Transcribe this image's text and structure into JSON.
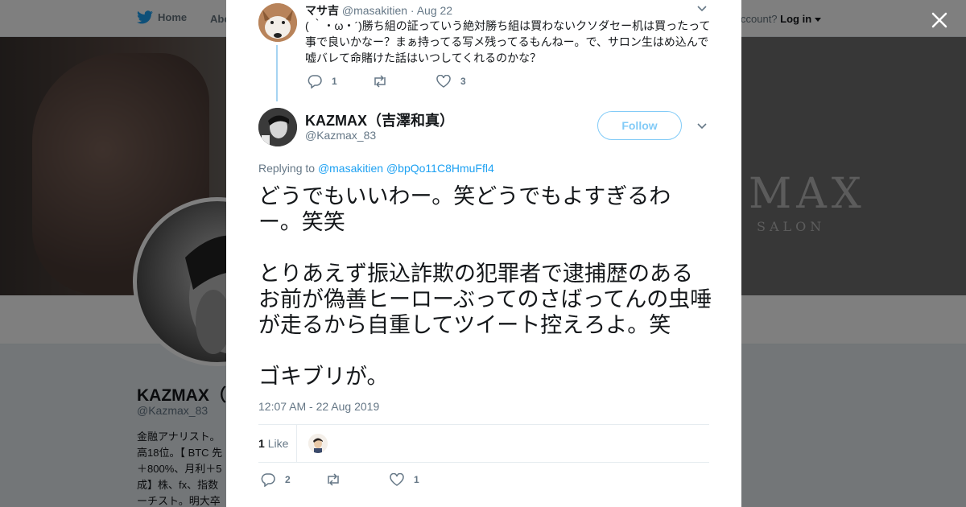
{
  "nav": {
    "home_label": "Home",
    "about_label": "Abo",
    "account_prompt": "ccount?",
    "login_label": "Log in"
  },
  "cover": {
    "logo_text": "MAX",
    "logo_sub": "SALON"
  },
  "profile": {
    "name": "KAZMAX（",
    "handle": "@Kazmax_83",
    "bio": "金融アナリスト。\n高18位。【 BTC 先\n＋800%、月利＋5\n成】株、fx、指数\nーチスト。明大卒"
  },
  "reply_tweet": {
    "name": "マサ吉",
    "handle": "@masakitien",
    "date": "Aug 22",
    "text": "( ｀・ω・´)勝ち組の証っていう絶対勝ち組は買わないクソダセー机は買ったって事で良いかなー？まぁ持ってる写メ残ってるもんねー。で、サロン生はめ込んで嘘バレて命賭けた話はいつしてくれるのかな？",
    "replies": "1",
    "retweets": "",
    "likes": "3"
  },
  "main_tweet": {
    "name": "KAZMAX（吉澤和真）",
    "handle": "@Kazmax_83",
    "follow_label": "Follow",
    "replying_to_label": "Replying to",
    "replying_to_1": "@masakitien",
    "replying_to_2": "@bpQo11C8HmuFfl4",
    "text_line1": "どうでもいいわー。笑どうでもよすぎるわー。笑笑",
    "text_line2": "とりあえず振込詐欺の犯罪者で逮捕歴のあるお前が偽善ヒーローぶってのさばってんの虫唾が走るから自重してツイート控えろよ。笑",
    "text_line3": "ゴキブリが。",
    "timestamp": "12:07 AM - 22 Aug 2019",
    "like_count": "1",
    "like_label": "Like",
    "replies": "2",
    "retweets": "",
    "likes": "1"
  },
  "colors": {
    "accent": "#1da1f2",
    "text": "#14171a",
    "muted": "#657786",
    "thread_line": "#a6d4f2"
  },
  "icons": [
    "twitter-bird-icon",
    "close-icon",
    "reply-icon",
    "retweet-icon",
    "heart-icon",
    "chevron-down-icon",
    "caret-down-icon"
  ]
}
